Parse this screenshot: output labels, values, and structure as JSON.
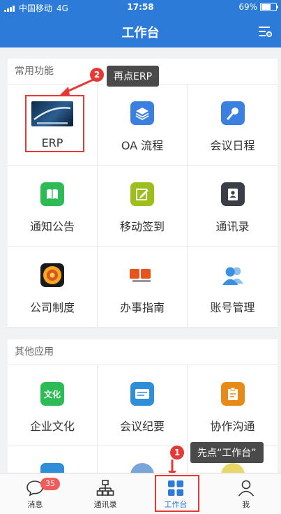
{
  "status_bar": {
    "carrier": "中国移动",
    "network": "4G",
    "time": "17:58",
    "battery": "69%"
  },
  "header": {
    "title": "工作台"
  },
  "section_common": {
    "title": "常用功能",
    "items": [
      {
        "label": "ERP",
        "icon": "erp-logo-icon"
      },
      {
        "label": "OA 流程",
        "icon": "layers-icon",
        "color": "#3b7fe0"
      },
      {
        "label": "会议日程",
        "icon": "microphone-icon",
        "color": "#3b7fe0"
      },
      {
        "label": "通知公告",
        "icon": "book-icon",
        "color": "#2dbb55"
      },
      {
        "label": "移动签到",
        "icon": "edit-icon",
        "color": "#9cbf1c"
      },
      {
        "label": "通讯录",
        "icon": "contacts-book-icon",
        "color": "#3a3f47"
      },
      {
        "label": "公司制度",
        "icon": "company-logo-icon",
        "color": "#f5a623"
      },
      {
        "label": "办事指南",
        "icon": "guide-icon",
        "color": "#e8541e"
      },
      {
        "label": "账号管理",
        "icon": "users-icon",
        "color": "#3b8ee0"
      }
    ]
  },
  "section_other": {
    "title": "其他应用",
    "items": [
      {
        "label": "企业文化",
        "icon": "culture-icon",
        "color": "#2dbb55",
        "icon_text": "文化"
      },
      {
        "label": "会议纪要",
        "icon": "meeting-minutes-icon",
        "color": "#2e8fd8"
      },
      {
        "label": "协作沟通",
        "icon": "clipboard-icon",
        "color": "#e88a1a"
      }
    ]
  },
  "annotations": {
    "step1_num": "1",
    "step1_text": "先点“工作台”",
    "step2_num": "2",
    "step2_text": "再点ERP"
  },
  "tabbar": {
    "tabs": [
      {
        "label": "消息",
        "badge": "35"
      },
      {
        "label": "通讯录"
      },
      {
        "label": "工作台",
        "active": true
      },
      {
        "label": "我"
      }
    ]
  },
  "colors": {
    "primary": "#2d7bd9",
    "highlight": "#e53935"
  }
}
